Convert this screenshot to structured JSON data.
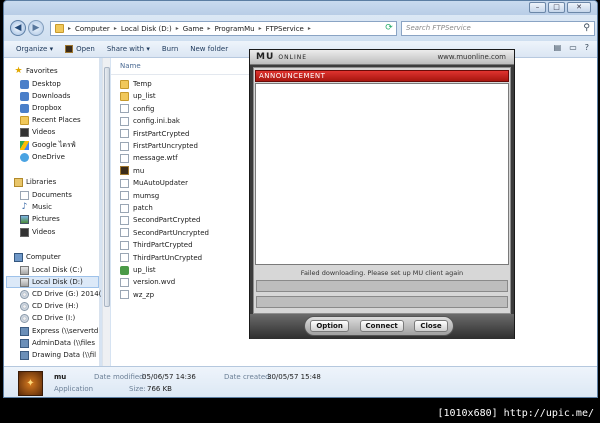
{
  "window": {
    "caption_buttons": [
      "–",
      "□",
      "✕"
    ]
  },
  "address": {
    "path": [
      "Computer",
      "Local Disk (D:)",
      "Game",
      "ProgramMu",
      "FTPService"
    ],
    "search_placeholder": "Search FTPService"
  },
  "toolbar": {
    "organize": "Organize ▾",
    "open": "Open",
    "share": "Share with ▾",
    "burn": "Burn",
    "new_folder": "New folder"
  },
  "nav": {
    "favorites_header": "Favorites",
    "favorites": [
      "Desktop",
      "Downloads",
      "Dropbox",
      "Recent Places",
      "Videos",
      "Google ไดรฟ์",
      "OneDrive"
    ],
    "libraries_header": "Libraries",
    "libraries": [
      "Documents",
      "Music",
      "Pictures",
      "Videos"
    ],
    "computer_header": "Computer",
    "computer": [
      "Local Disk (C:)",
      "Local Disk (D:)",
      "CD Drive (G:) 2014(",
      "CD Drive (H:)",
      "CD Drive (I:)",
      "Express (\\\\servertd",
      "AdminData (\\\\files",
      "Drawing Data (\\\\fil"
    ]
  },
  "list": {
    "column_name": "Name",
    "files": [
      {
        "name": "Temp",
        "icon": "folder-icon"
      },
      {
        "name": "up_list",
        "icon": "folder-icon"
      },
      {
        "name": "config",
        "icon": "file-icon"
      },
      {
        "name": "config.ini.bak",
        "icon": "file-icon"
      },
      {
        "name": "FirstPartCrypted",
        "icon": "file-icon"
      },
      {
        "name": "FirstPartUncrypted",
        "icon": "file-icon"
      },
      {
        "name": "message.wtf",
        "icon": "file-icon"
      },
      {
        "name": "mu",
        "icon": "mu-exe-icon"
      },
      {
        "name": "MuAutoUpdater",
        "icon": "file-icon"
      },
      {
        "name": "mumsg",
        "icon": "file-icon"
      },
      {
        "name": "patch",
        "icon": "file-icon"
      },
      {
        "name": "SecondPartCrypted",
        "icon": "file-icon"
      },
      {
        "name": "SecondPartUncrypted",
        "icon": "file-icon"
      },
      {
        "name": "ThirdPartCrypted",
        "icon": "file-icon"
      },
      {
        "name": "ThirdPartUnCrypted",
        "icon": "file-icon"
      },
      {
        "name": "up_list",
        "icon": "archive-icon"
      },
      {
        "name": "version.wvd",
        "icon": "file-icon"
      },
      {
        "name": "wz_zp",
        "icon": "file-icon"
      }
    ]
  },
  "details": {
    "name": "mu",
    "type": "Application",
    "date_modified_label": "Date modified:",
    "date_modified": "05/06/57 14:36",
    "date_created_label": "Date created:",
    "date_created": "30/05/57 15:48",
    "size_label": "Size:",
    "size": "766 KB"
  },
  "mu_dialog": {
    "logo": "MU",
    "logo_sub": "ONLINE",
    "url": "www.muonline.com",
    "announcement": "ANNOUNCEMENT",
    "status": "Failed downloading. Please set up MU client again",
    "option": "Option",
    "connect": "Connect",
    "close": "Close"
  },
  "watermark": "[1010x680] http://upic.me/"
}
